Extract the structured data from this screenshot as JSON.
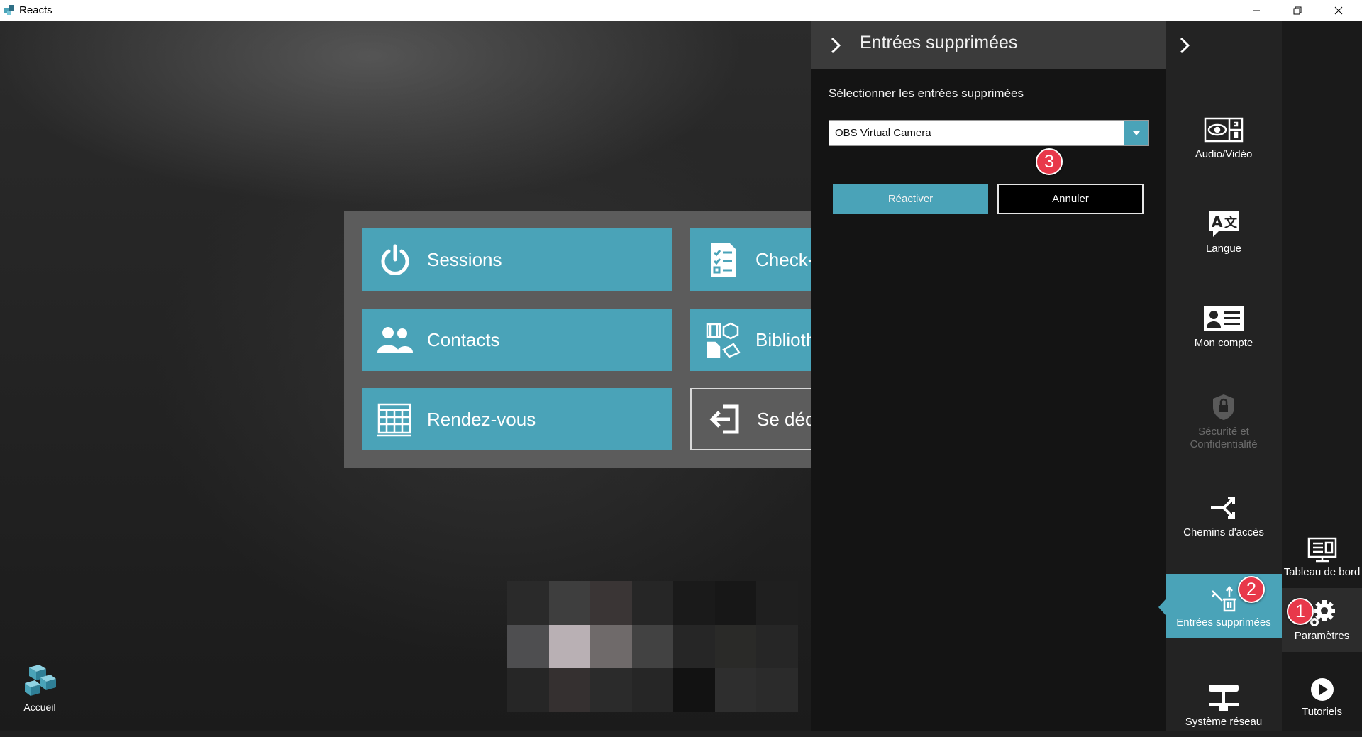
{
  "window": {
    "title": "Reacts"
  },
  "menu_tiles": [
    {
      "label": "Sessions",
      "icon": "power-icon"
    },
    {
      "label": "Check-I",
      "icon": "checklist-icon"
    },
    {
      "label": "Contacts",
      "icon": "contacts-icon"
    },
    {
      "label": "Biblioth",
      "icon": "library-icon"
    },
    {
      "label": "Rendez-vous",
      "icon": "calendar-icon"
    },
    {
      "label": "Se déco",
      "icon": "logout-icon"
    }
  ],
  "deleted_panel": {
    "title": "Entrées supprimées",
    "select_label": "Sélectionner les entrées supprimées",
    "selected_value": "OBS Virtual Camera",
    "reactivate_label": "Réactiver",
    "cancel_label": "Annuler"
  },
  "settings_menu": [
    {
      "label": "Audio/Vidéo",
      "icon": "webcam-icon"
    },
    {
      "label": "Langue",
      "icon": "translate-icon"
    },
    {
      "label": "Mon compte",
      "icon": "id-card-icon"
    },
    {
      "label": "Sécurité et Confidentialité",
      "icon": "shield-lock-icon",
      "disabled": true
    },
    {
      "label": "Chemins d'accès",
      "icon": "paths-icon"
    },
    {
      "label": "Entrées supprimées",
      "icon": "trash-restore-icon",
      "active": true
    },
    {
      "label": "Système réseau",
      "icon": "network-icon"
    }
  ],
  "nav_menu": [
    {
      "label": "Tableau de bord",
      "icon": "dashboard-icon"
    },
    {
      "label": "Paramètres",
      "icon": "gear-icon",
      "selected": true
    },
    {
      "label": "Tutoriels",
      "icon": "play-icon"
    }
  ],
  "home": {
    "label": "Accueil",
    "icon": "home-logo-icon"
  },
  "badges": [
    "1",
    "2",
    "3"
  ],
  "colors": {
    "accent": "#4aa3b8",
    "badge": "#e8384a"
  }
}
